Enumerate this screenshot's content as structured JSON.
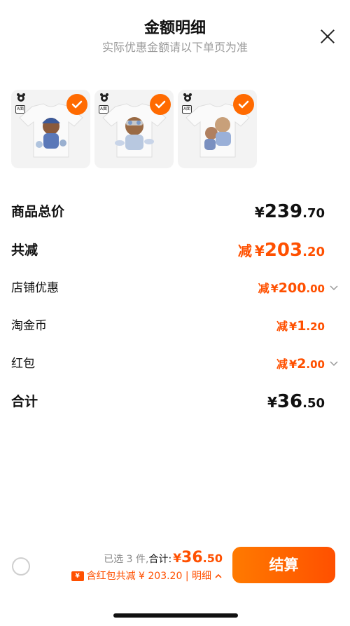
{
  "header": {
    "title": "金额明细",
    "subtitle": "实际优惠金额请以下单页为准"
  },
  "products": [
    {
      "tag": "A面",
      "selected": true,
      "icon": "bear-tshirt-blue"
    },
    {
      "tag": "A面",
      "selected": true,
      "icon": "bear-tshirt-pilot"
    },
    {
      "tag": "A面",
      "selected": true,
      "icon": "bear-tshirt-double"
    }
  ],
  "breakdown": {
    "total_price": {
      "label": "商品总价",
      "yen": "¥",
      "int": "239",
      "dec": ".70"
    },
    "total_discount": {
      "label": "共减",
      "prefix": "减",
      "yen": "¥",
      "int": "203",
      "dec": ".20"
    },
    "store_discount": {
      "label": "店铺优惠",
      "prefix": "减",
      "yen": "¥",
      "int": "200",
      "dec": ".00"
    },
    "taojinbi": {
      "label": "淘金币",
      "prefix": "减",
      "yen": "¥",
      "int": "1",
      "dec": ".20"
    },
    "red_packet": {
      "label": "红包",
      "prefix": "减",
      "yen": "¥",
      "int": "2",
      "dec": ".00"
    },
    "subtotal": {
      "label": "合计",
      "yen": "¥",
      "int": "36",
      "dec": ".50"
    }
  },
  "footer": {
    "selected_text": "已选 3 件,",
    "total_label": "合计:",
    "yen": "¥",
    "total_int": "36",
    "total_dec": ".50",
    "coupon_icon_text": "¥",
    "discount_text": "含红包共减 ¥ 203.20 | 明细",
    "settle_label": "结算"
  },
  "colors": {
    "accent": "#ff5000",
    "accent_light": "#ff7a00"
  }
}
